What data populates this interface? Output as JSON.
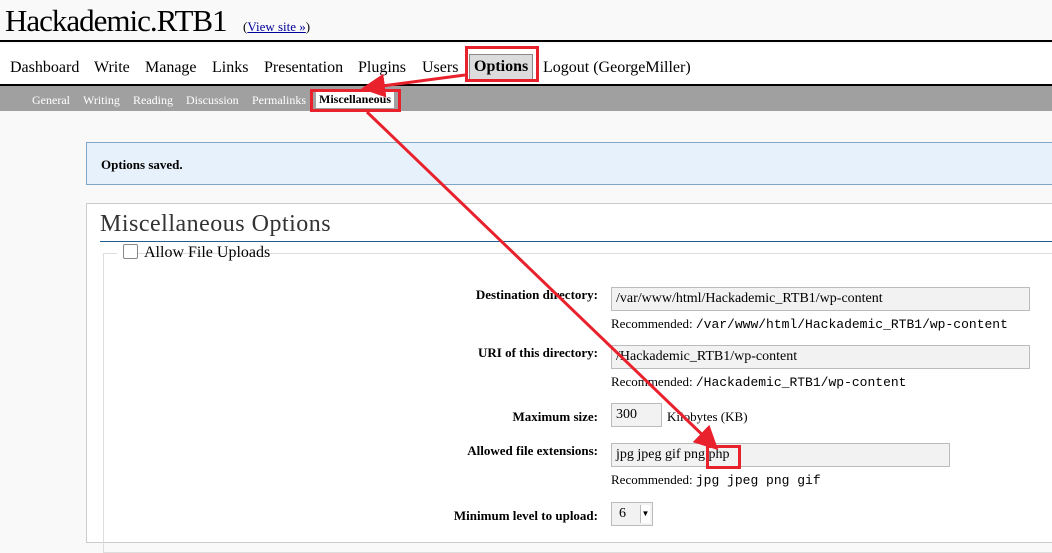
{
  "header": {
    "site_title": "Hackademic.RTB1",
    "view_site_prefix": "(",
    "view_site_link": "View site »",
    "view_site_suffix": ")"
  },
  "menu": {
    "items": [
      "Dashboard",
      "Write",
      "Manage",
      "Links",
      "Presentation",
      "Plugins",
      "Users",
      "Options",
      "Logout (GeorgeMiller)"
    ],
    "active": "Options"
  },
  "submenu": {
    "items": [
      "General",
      "Writing",
      "Reading",
      "Discussion",
      "Permalinks",
      "Miscellaneous"
    ],
    "active": "Miscellaneous"
  },
  "notice": "Options saved.",
  "page": {
    "title": "Miscellaneous Options",
    "uploads_legend": "Allow File Uploads",
    "allow_uploads_checked": false
  },
  "form": {
    "recommended_label": "Recommended:",
    "destination": {
      "label": "Destination directory:",
      "value": "/var/www/html/Hackademic_RTB1/wp-content",
      "recommended": "/var/www/html/Hackademic_RTB1/wp-content"
    },
    "uri": {
      "label": "URI of this directory:",
      "value": "/Hackademic_RTB1/wp-content",
      "recommended": "/Hackademic_RTB1/wp-content"
    },
    "max_size": {
      "label": "Maximum size:",
      "value": "300",
      "unit": "Kilobytes (KB)"
    },
    "extensions": {
      "label": "Allowed file extensions:",
      "value": "jpg jpeg gif png php",
      "recommended": "jpg jpeg png gif"
    },
    "min_level": {
      "label": "Minimum level to upload:",
      "value": "6"
    }
  },
  "annotation_color": "#e8212c"
}
